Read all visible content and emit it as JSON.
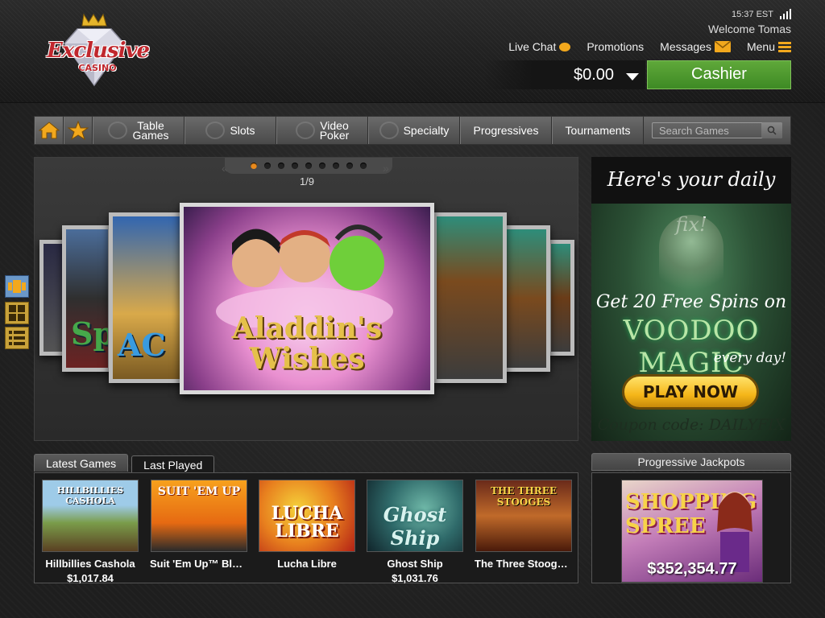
{
  "header": {
    "logo_text": "Exclusive",
    "logo_sub": "CASINO",
    "time": "15:37 EST",
    "welcome": "Welcome Tomas",
    "nav": {
      "live_chat": "Live Chat",
      "promotions": "Promotions",
      "messages": "Messages",
      "menu": "Menu"
    },
    "balance": "$0.00",
    "cashier_label": "Cashier",
    "accent_color": "#f2a81d",
    "cashier_color": "#4b9a2e"
  },
  "categories": {
    "table_games": "Table\nGames",
    "slots": "Slots",
    "video_poker": "Video\nPoker",
    "specialty": "Specialty",
    "progressives": "Progressives",
    "tournaments": "Tournaments",
    "search_placeholder": "Search Games"
  },
  "carousel": {
    "page_counter": "1/9",
    "dot_count": 9,
    "active_dot": 1,
    "featured_title": "Aladdin's Wishes",
    "side_titles": {
      "left1": "AC",
      "left2": "Sp"
    }
  },
  "promo": {
    "headline": "Here's your daily fix!",
    "line1": "Get 20 Free Spins on",
    "line2": "VOODOO MAGIC",
    "line3": "every day!",
    "button": "PLAY NOW",
    "coupon": "Coupon code: DAILYFIX"
  },
  "tabs": {
    "latest": "Latest Games",
    "last_played": "Last Played"
  },
  "latest_games": [
    {
      "name": "Hillbillies Cashola",
      "jackpot": "$1,017.84",
      "thumb_text": "HILLBILLIES CASHOLA"
    },
    {
      "name": "Suit 'Em Up™ Bla…",
      "jackpot": "",
      "thumb_text": "SUIT 'EM UP"
    },
    {
      "name": "Lucha Libre",
      "jackpot": "",
      "thumb_text": "LUCHA LIBRE"
    },
    {
      "name": "Ghost Ship",
      "jackpot": "$1,031.76",
      "thumb_text": "Ghost Ship"
    },
    {
      "name": "The Three Stooge…",
      "jackpot": "",
      "thumb_text": "THE THREE STOOGES"
    }
  ],
  "progressive": {
    "header": "Progressive Jackpots",
    "game_title": "SHOPPING SPREE",
    "amount": "$352,354.77"
  }
}
